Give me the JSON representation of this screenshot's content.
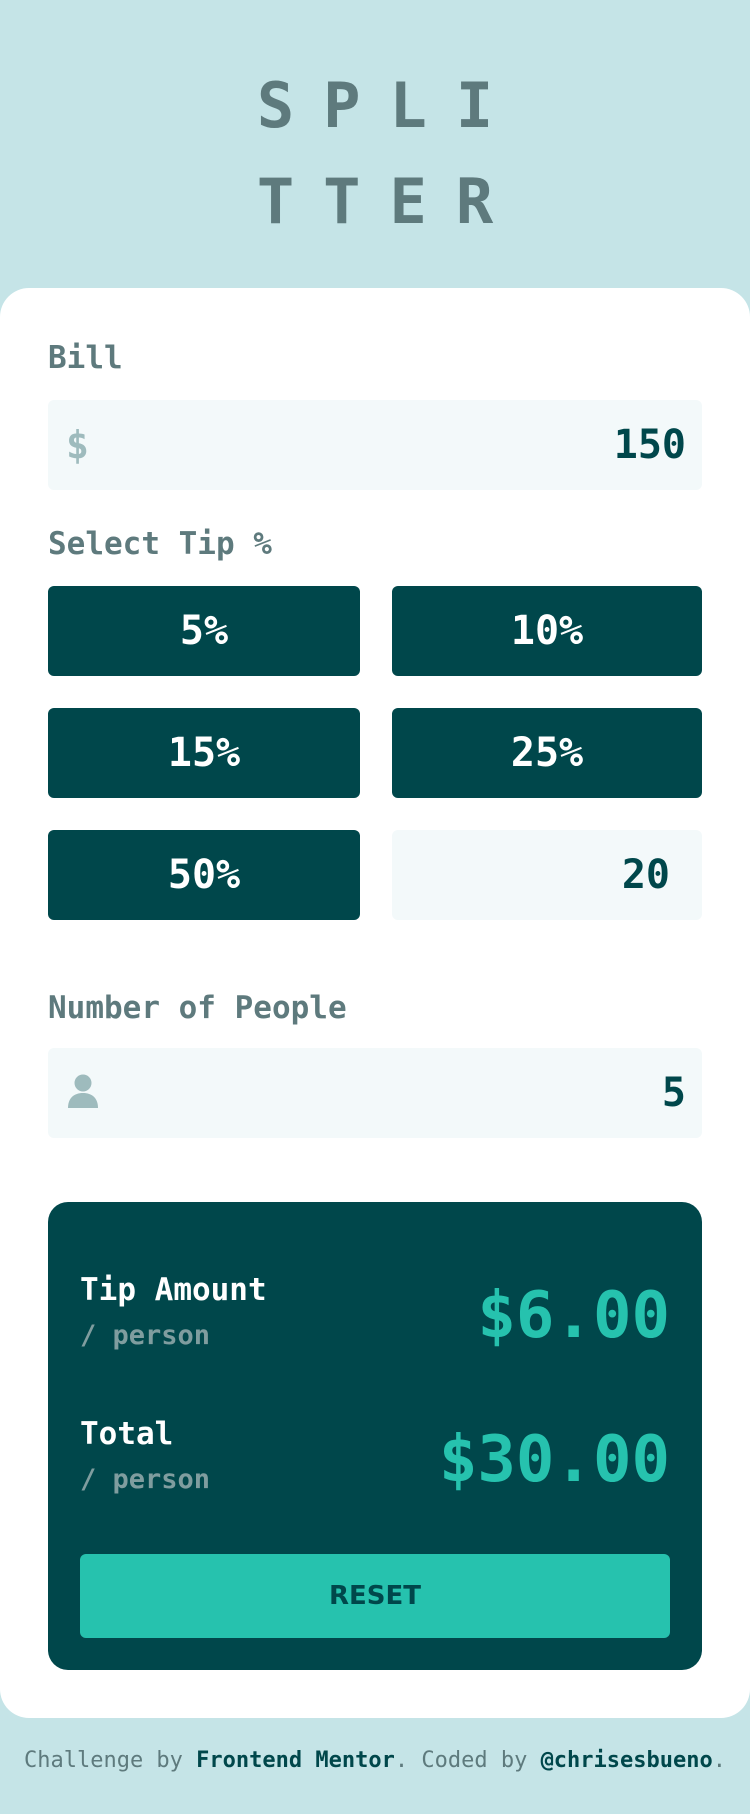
{
  "logo": {
    "line1": "SPLI",
    "line2": "TTER"
  },
  "bill": {
    "label": "Bill",
    "currency_symbol": "$",
    "value": "150"
  },
  "tip": {
    "label": "Select Tip %",
    "options": [
      "5%",
      "10%",
      "15%",
      "25%",
      "50%"
    ],
    "custom_value": "20"
  },
  "people": {
    "label": "Number of People",
    "value": "5"
  },
  "results": {
    "tip_label": "Tip Amount",
    "tip_sub": "/ person",
    "tip_value": "$6.00",
    "total_label": "Total",
    "total_sub": "/ person",
    "total_value": "$30.00",
    "reset_label": "RESET"
  },
  "footer": {
    "prefix": "Challenge by ",
    "link1": "Frontend Mentor",
    "middle": ". Coded by ",
    "link2": "@chrisesbueno",
    "suffix": "."
  },
  "icons": {
    "bill": "dollar-icon",
    "people": "person-icon"
  },
  "colors": {
    "background": "#c5e4e7",
    "dark_teal": "#00474b",
    "accent": "#26c2ae",
    "input_bg": "#f3f9fa",
    "label": "#5e7a7d"
  }
}
